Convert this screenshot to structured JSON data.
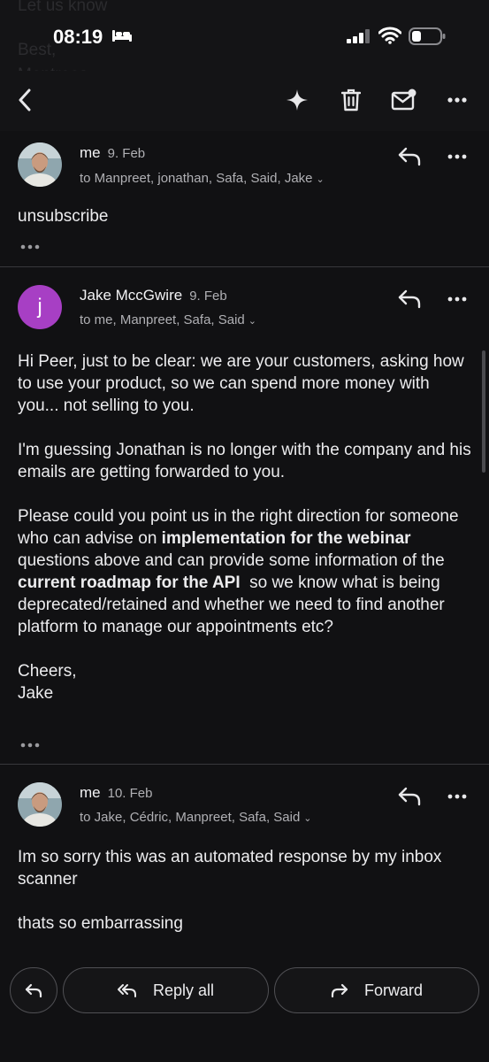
{
  "status": {
    "time": "08:19",
    "background_ghost_text": [
      "Let us know",
      "Best,",
      "Montrees"
    ]
  },
  "toolbar": {
    "back_icon": "chevron-left-icon",
    "icons": [
      "sparkle-icon",
      "trash-icon",
      "mark-unread-icon",
      "more-icon"
    ]
  },
  "messages": [
    {
      "sender": "me",
      "date": "9. Feb",
      "recipients": "to Manpreet, jonathan, Safa, Said, Jake",
      "avatar": "photo",
      "paragraphs": [
        "unsubscribe"
      ]
    },
    {
      "sender": "Jake MccGwire",
      "date": "9. Feb",
      "recipients": "to me, Manpreet, Safa, Said",
      "avatar_letter": "j",
      "avatar_color": "#a73fc4",
      "p1": "Hi Peer, just to be clear: we are your customers, asking how to use your product, so we can spend more money with you... not selling to you.",
      "p2": "I'm guessing Jonathan is no longer with the company and his emails are getting forwarded to you.",
      "p3_a": "Please could you point us in the right direction for someone who can advise on ",
      "p3_b": "implementation for the webinar",
      "p3_c": " questions above and can provide some information of the ",
      "p3_d": "current roadmap for the API",
      "p3_e": "  so we know what is being deprecated/retained and whether we need to find another platform to manage our appointments etc?",
      "p4_a": "Cheers,",
      "p4_b": "Jake"
    },
    {
      "sender": "me",
      "date": "10. Feb",
      "recipients": "to Jake, Cédric, Manpreet, Safa, Said",
      "avatar": "photo",
      "p1": "Im so sorry this was an automated response by my inbox scanner",
      "p2": "thats so embarrassing"
    }
  ],
  "actions": {
    "reply_all": "Reply all",
    "forward": "Forward"
  },
  "colors": {
    "background": "#111113",
    "accent_avatar": "#a73fc4"
  }
}
